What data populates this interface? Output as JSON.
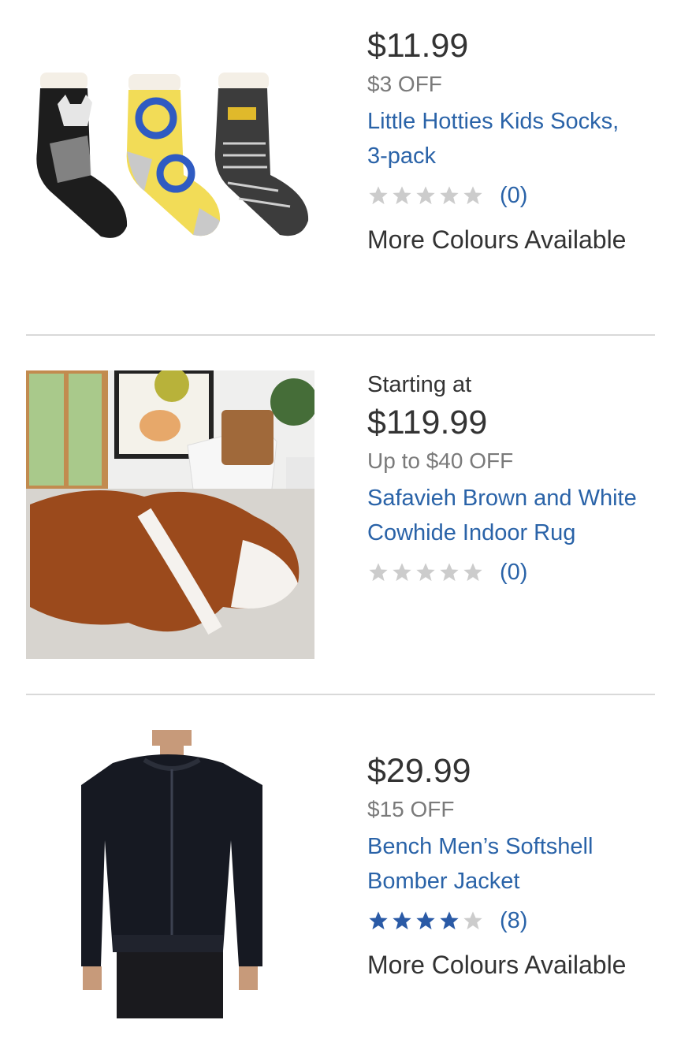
{
  "products": [
    {
      "price": "$11.99",
      "discount": "$3 OFF",
      "title_line1": "Little Hotties Kids Socks,",
      "title_line2": "3-pack",
      "rating": 0,
      "review_count": "(0)",
      "more": "More Colours Available",
      "image": "kids-socks-image"
    },
    {
      "starting": "Starting at",
      "price": "$119.99",
      "discount": "Up to $40 OFF",
      "title_line1": "Safavieh Brown and White",
      "title_line2": "Cowhide Indoor Rug",
      "rating": 0,
      "review_count": "(0)",
      "image": "cowhide-rug-image"
    },
    {
      "price": "$29.99",
      "discount": "$15 OFF",
      "title_line1": "Bench Men’s Softshell",
      "title_line2": "Bomber Jacket",
      "rating": 4,
      "review_count": "(8)",
      "more": "More Colours Available",
      "image": "bomber-jacket-image"
    }
  ],
  "colors": {
    "link": "#2a63a8",
    "star_filled": "#2a5aa6",
    "star_empty": "#cccccc",
    "divider": "#d9d9d9"
  }
}
